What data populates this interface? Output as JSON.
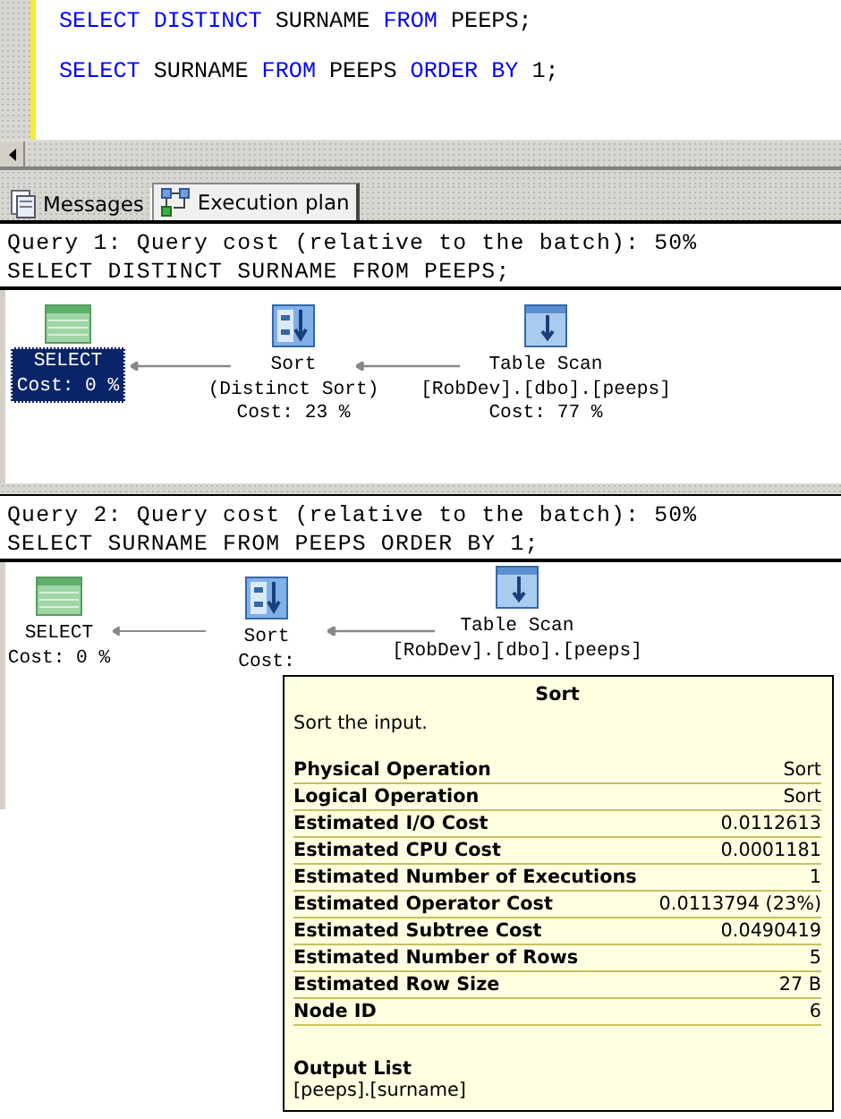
{
  "editor": {
    "lines": [
      [
        {
          "kind": "keyword",
          "text": "SELECT"
        },
        {
          "kind": "keyword",
          "text": "DISTINCT"
        },
        {
          "kind": "plain",
          "text": "SURNAME"
        },
        {
          "kind": "keyword",
          "text": "FROM"
        },
        {
          "kind": "plain",
          "text": "PEEPS;"
        }
      ],
      [
        {
          "kind": "keyword",
          "text": "SELECT"
        },
        {
          "kind": "plain",
          "text": "SURNAME"
        },
        {
          "kind": "keyword",
          "text": "FROM"
        },
        {
          "kind": "plain",
          "text": "PEEPS"
        },
        {
          "kind": "keyword",
          "text": "ORDER"
        },
        {
          "kind": "keyword",
          "text": "BY"
        },
        {
          "kind": "plain",
          "text": "1;"
        }
      ]
    ]
  },
  "tabs": [
    {
      "label": "Messages",
      "selected": false
    },
    {
      "label": "Execution plan",
      "selected": true
    }
  ],
  "queries": [
    {
      "header": "Query 1: Query cost (relative to the batch): 50%",
      "sql": "SELECT DISTINCT SURNAME FROM PEEPS;",
      "nodes": [
        {
          "lines": [
            "SELECT",
            "Cost: 0 %"
          ],
          "selected": true
        },
        {
          "lines": [
            "Sort",
            "(Distinct Sort)",
            "Cost: 23 %"
          ],
          "selected": false
        },
        {
          "lines": [
            "Table Scan",
            "[RobDev].[dbo].[peeps]",
            "Cost: 77 %"
          ],
          "selected": false
        }
      ]
    },
    {
      "header": "Query 2: Query cost (relative to the batch): 50%",
      "sql": "SELECT SURNAME FROM PEEPS ORDER BY 1;",
      "nodes": [
        {
          "lines": [
            "SELECT",
            "Cost: 0 %"
          ],
          "selected": false
        },
        {
          "lines": [
            "Sort",
            "Cost:"
          ],
          "selected": false
        },
        {
          "lines": [
            "Table Scan",
            "[RobDev].[dbo].[peeps]"
          ],
          "selected": false
        }
      ]
    }
  ],
  "tooltip": {
    "title": "Sort",
    "description": "Sort the input.",
    "properties": [
      {
        "name": "Physical Operation",
        "value": "Sort"
      },
      {
        "name": "Logical Operation",
        "value": "Sort"
      },
      {
        "name": "Estimated I/O Cost",
        "value": "0.0112613"
      },
      {
        "name": "Estimated CPU Cost",
        "value": "0.0001181"
      },
      {
        "name": "Estimated Number of Executions",
        "value": "1"
      },
      {
        "name": "Estimated Operator Cost",
        "value": "0.0113794 (23%)"
      },
      {
        "name": "Estimated Subtree Cost",
        "value": "0.0490419"
      },
      {
        "name": "Estimated Number of Rows",
        "value": "5"
      },
      {
        "name": "Estimated Row Size",
        "value": "27 B"
      },
      {
        "name": "Node ID",
        "value": "6"
      }
    ],
    "output_label": "Output List",
    "output_value": "[peeps].[surname]"
  }
}
